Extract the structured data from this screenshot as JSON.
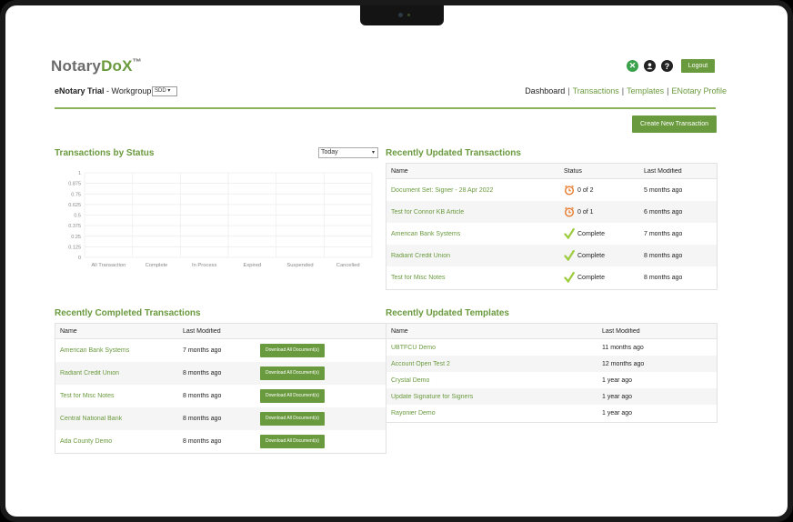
{
  "app": {
    "logo_main": "Notary",
    "logo_accent": "DoX",
    "logo_tm": "™",
    "logout_label": "Logout"
  },
  "workgroup": {
    "account": "eNotary Trial",
    "suffix": " - Workgroup",
    "select_value": "SDD"
  },
  "nav": {
    "dashboard": "Dashboard",
    "transactions": "Transactions",
    "templates": "Templates",
    "profile": "ENotary Profile",
    "separator": "|"
  },
  "create_button": "Create New Transaction",
  "status_chart": {
    "title": "Transactions by Status",
    "period_value": "Today",
    "chart_data": {
      "type": "bar",
      "categories": [
        "All Transaction",
        "Complete",
        "In Process",
        "Expired",
        "Suspended",
        "Cancelled"
      ],
      "values": [
        0,
        0,
        0,
        0,
        0,
        0
      ],
      "ylim": [
        0,
        1
      ],
      "yticks": [
        "1",
        "0.875",
        "0.75",
        "0.625",
        "0.5",
        "0.375",
        "0.25",
        "0.125",
        "0"
      ],
      "grid": true
    }
  },
  "recent_transactions": {
    "title": "Recently Updated Transactions",
    "headers": [
      "Name",
      "Status",
      "Last Modified"
    ],
    "rows": [
      {
        "name": "Document Set: Signer - 28 Apr 2022",
        "status": "0 of 2",
        "status_icon": "clock-icon",
        "modified": "5 months ago"
      },
      {
        "name": "Test for Connor KB Article",
        "status": "0 of 1",
        "status_icon": "clock-icon",
        "modified": "6 months ago"
      },
      {
        "name": "American Bank Systems",
        "status": "Complete",
        "status_icon": "check-icon",
        "modified": "7 months ago"
      },
      {
        "name": "Radiant Credit Union",
        "status": "Complete",
        "status_icon": "check-icon",
        "modified": "8 months ago"
      },
      {
        "name": "Test for Misc Notes",
        "status": "Complete",
        "status_icon": "check-icon",
        "modified": "8 months ago"
      }
    ]
  },
  "completed_transactions": {
    "title": "Recently Completed Transactions",
    "headers": [
      "Name",
      "Last Modified"
    ],
    "download_label": "Download All Document(s)",
    "rows": [
      {
        "name": "American Bank Systems",
        "modified": "7 months ago"
      },
      {
        "name": "Radiant Credit Union",
        "modified": "8 months ago"
      },
      {
        "name": "Test for Misc Notes",
        "modified": "8 months ago"
      },
      {
        "name": "Central National Bank",
        "modified": "8 months ago"
      },
      {
        "name": "Ada County Demo",
        "modified": "8 months ago"
      }
    ]
  },
  "templates": {
    "title": "Recently Updated Templates",
    "headers": [
      "Name",
      "Last Modified"
    ],
    "rows": [
      {
        "name": "UBTFCU Demo",
        "modified": "11 months ago"
      },
      {
        "name": "Account Open Test 2",
        "modified": "12 months ago"
      },
      {
        "name": "Crystal Demo",
        "modified": "1 year ago"
      },
      {
        "name": "Update Signature for Signers",
        "modified": "1 year ago"
      },
      {
        "name": "Rayonier Demo",
        "modified": "1 year ago"
      }
    ]
  },
  "colors": {
    "brand_green": "#6a9a3e",
    "status_pending": "#e8792b",
    "status_complete": "#9ccc3c"
  }
}
